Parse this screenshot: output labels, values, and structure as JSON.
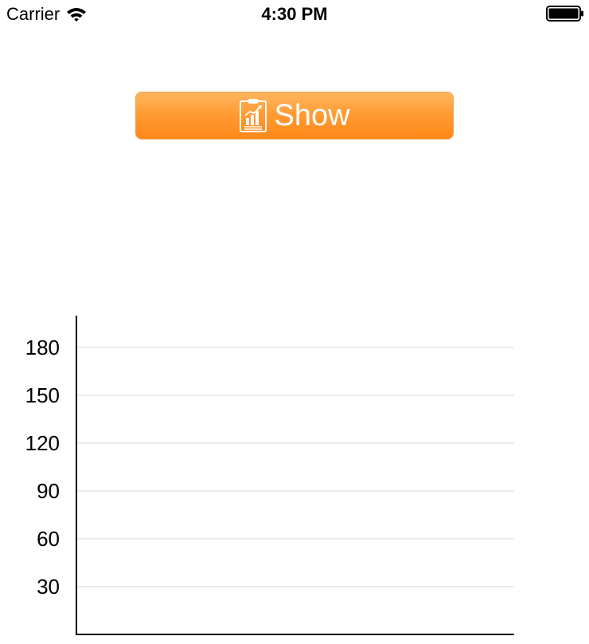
{
  "status_bar": {
    "carrier": "Carrier",
    "time": "4:30 PM",
    "wifi_icon": "wifi-icon",
    "battery_icon": "battery-full-icon"
  },
  "show_button": {
    "label": "Show",
    "icon": "report-chart-icon",
    "gradient_top": "#ffb65e",
    "gradient_bottom": "#ff8818"
  },
  "chart_data": {
    "type": "bar",
    "title": "",
    "xlabel": "",
    "ylabel": "",
    "categories": [],
    "values": [],
    "y_ticks": [
      30,
      60,
      90,
      120,
      150,
      180
    ],
    "ylim": [
      0,
      200
    ],
    "grid": true,
    "gridline_color": "#ececec",
    "axis_color": "#000000"
  }
}
